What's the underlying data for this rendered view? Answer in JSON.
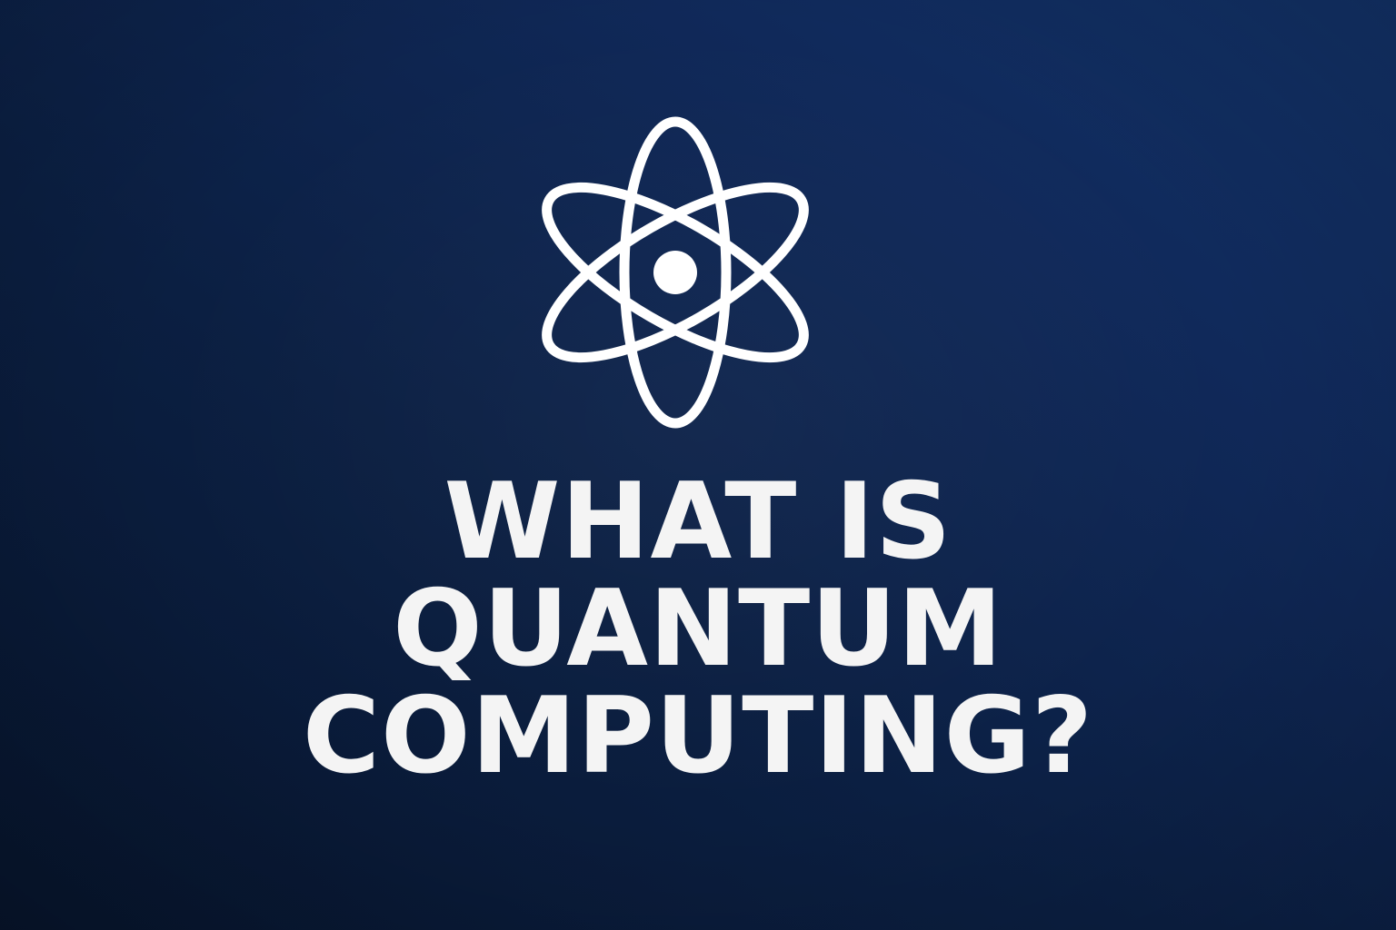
{
  "icon": {
    "name": "atom-icon",
    "color": "#ffffff"
  },
  "headline": {
    "lines": [
      "WHAT IS",
      "QUANTUM",
      "COMPUTING?"
    ]
  },
  "colors": {
    "background_dark": "#07152d",
    "background_light": "#123268",
    "text": "#f4f4f4"
  }
}
